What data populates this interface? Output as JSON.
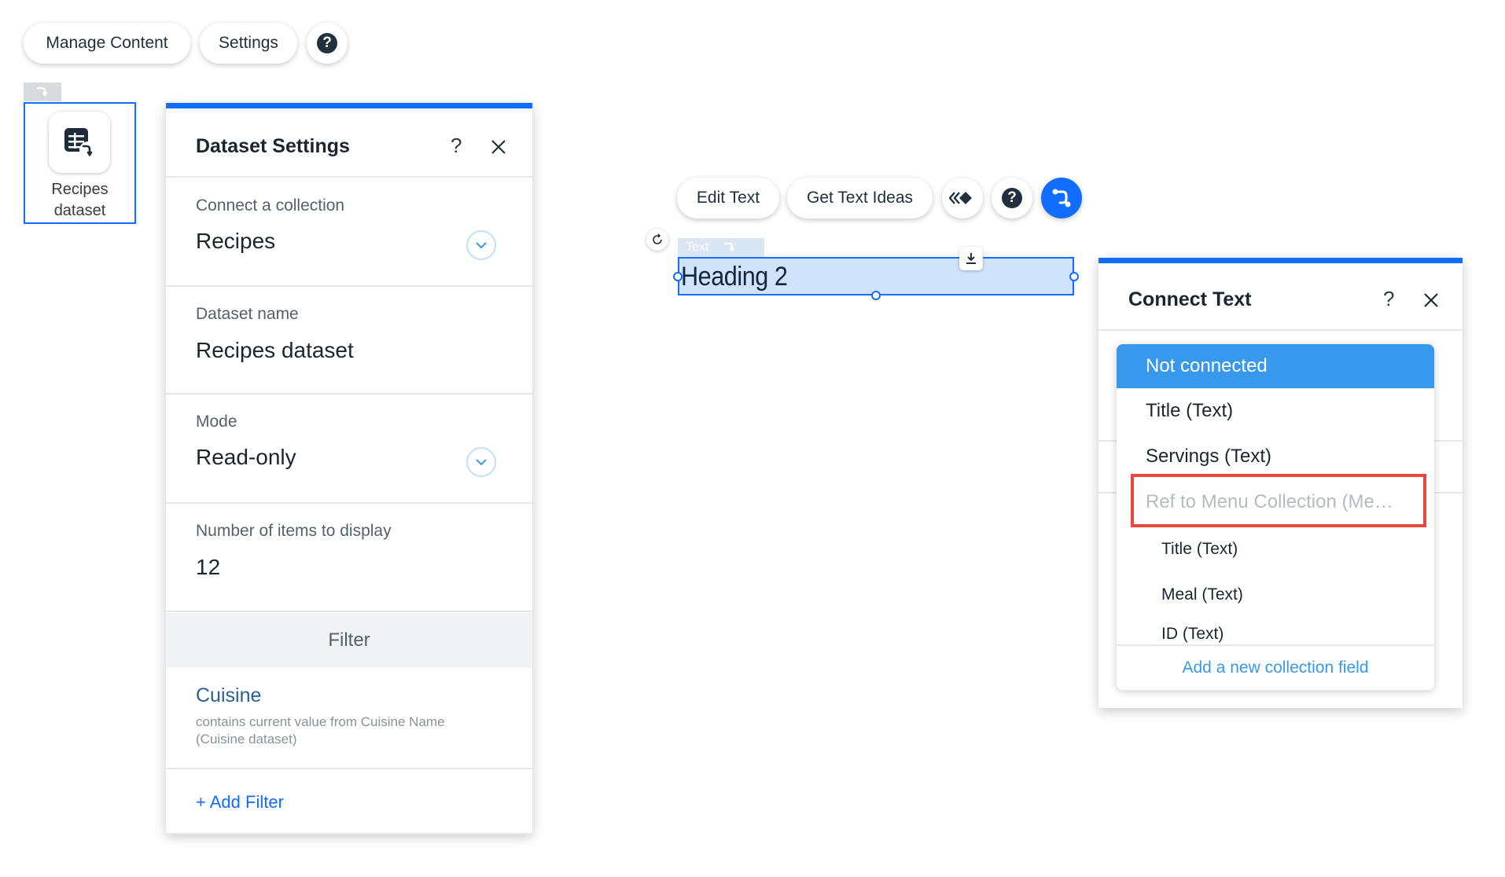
{
  "toolbar": {
    "manage_content": "Manage Content",
    "settings": "Settings",
    "help": "?"
  },
  "dataset_widget": {
    "label_line1": "Recipes",
    "label_line2": "dataset"
  },
  "dataset_settings": {
    "title": "Dataset Settings",
    "help": "?",
    "connect_label": "Connect a collection",
    "connect_value": "Recipes",
    "name_label": "Dataset name",
    "name_value": "Recipes dataset",
    "mode_label": "Mode",
    "mode_value": "Read-only",
    "items_label": "Number of items to display",
    "items_value": "12",
    "filter_header": "Filter",
    "filter_field": "Cuisine",
    "filter_desc": "contains current value from Cuisine Name (Cuisine dataset)",
    "add_filter": "+ Add Filter"
  },
  "text_toolbar": {
    "edit_text": "Edit Text",
    "get_text_ideas": "Get Text Ideas",
    "help": "?"
  },
  "text_element": {
    "tag": "Text",
    "content": "Heading 2"
  },
  "connect_text": {
    "title": "Connect Text",
    "help": "?",
    "options": [
      {
        "label": "Not connected",
        "selected": true
      },
      {
        "label": "Title (Text)"
      },
      {
        "label": "Servings (Text)"
      },
      {
        "label": "Ref to Menu Collection (Me…",
        "disabled": true
      },
      {
        "label": "Title (Text)",
        "indent": true
      },
      {
        "label": "Meal (Text)",
        "indent": true
      },
      {
        "label": "ID (Text)",
        "indent": true
      }
    ],
    "add_field": "Add a new collection field"
  },
  "colors": {
    "accent": "#116dff",
    "selected_option": "#3899ec",
    "highlight_border": "#e8463f"
  }
}
